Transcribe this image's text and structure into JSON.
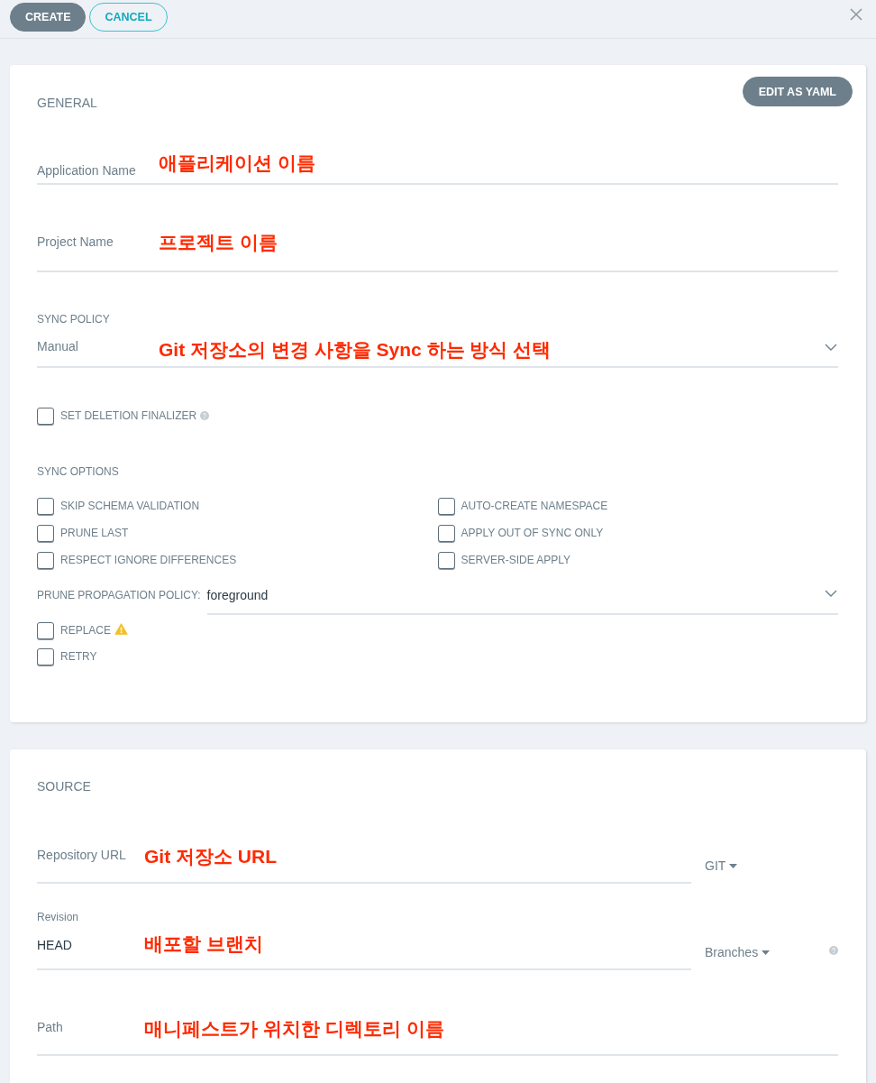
{
  "toolbar": {
    "buttons": [
      {
        "label": "CREATE",
        "kind": "primary"
      },
      {
        "label": "CANCEL",
        "kind": "outline"
      }
    ]
  },
  "general": {
    "title": "GENERAL",
    "edit_button": "EDIT AS YAML",
    "fields": [
      {
        "kind": "text",
        "placeholder": "Application Name",
        "annotation": "애플리케이션 이름"
      },
      {
        "kind": "text",
        "placeholder": "Project Name",
        "annotation": "프로젝트 이름"
      },
      {
        "kind": "select",
        "label": "SYNC POLICY",
        "value": "Manual",
        "annotation": "Git 저장소의 변경 사항을 Sync 하는 방식 선택"
      }
    ],
    "finalizer": {
      "label": "SET DELETION FINALIZER",
      "checked": false,
      "kind": "help"
    }
  },
  "sync_options": {
    "title": "SYNC OPTIONS",
    "options": [
      {
        "label": "SKIP SCHEMA VALIDATION",
        "checked": false
      },
      {
        "label": "AUTO-CREATE NAMESPACE",
        "checked": false
      },
      {
        "label": "PRUNE LAST",
        "checked": false
      },
      {
        "label": "APPLY OUT OF SYNC ONLY",
        "checked": false
      },
      {
        "label": "RESPECT IGNORE DIFFERENCES",
        "checked": false
      },
      {
        "label": "SERVER-SIDE APPLY",
        "checked": false
      }
    ],
    "prune_propagation_policy": {
      "label": "PRUNE PROPAGATION POLICY:",
      "value": "foreground"
    },
    "more_options": [
      {
        "label": "REPLACE",
        "checked": false,
        "kind": "warning"
      },
      {
        "label": "RETRY",
        "checked": false,
        "kind": "plain"
      }
    ]
  },
  "source": {
    "title": "SOURCE",
    "fields": [
      {
        "kind": "text",
        "placeholder": "Repository URL",
        "annotation": "Git 저장소 URL",
        "type_selector": "GIT"
      },
      {
        "kind": "value",
        "label": "Revision",
        "value": "HEAD",
        "annotation": "배포할 브랜치",
        "type_selector": "Branches",
        "help": true
      },
      {
        "kind": "text",
        "placeholder": "Path",
        "annotation": "매니페스트가 위치한 디렉토리 이름"
      }
    ]
  }
}
